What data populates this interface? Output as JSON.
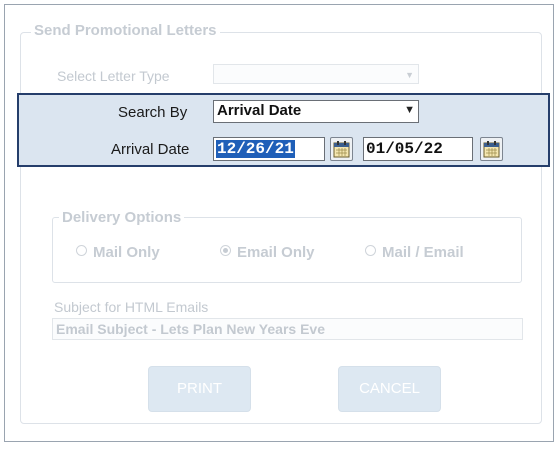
{
  "dialog": {
    "group_title": "Send Promotional Letters",
    "letter_type_label": "Select Letter Type",
    "letter_type_value": ""
  },
  "search": {
    "search_by_label": "Search By",
    "search_by_value": "Arrival Date",
    "date_label": "Arrival Date",
    "date_from": "12/26/21",
    "date_to": "01/05/22"
  },
  "delivery": {
    "title": "Delivery  Options",
    "options": [
      "Mail Only",
      "Email Only",
      "Mail / Email"
    ],
    "selected": "Email Only"
  },
  "email": {
    "subject_label": "Subject for HTML Emails",
    "subject_value": "Email Subject - Lets Plan New Years Eve"
  },
  "buttons": {
    "print": "PRINT",
    "cancel": "CANCEL"
  },
  "colors": {
    "highlight_bg": "#dbe5f0",
    "highlight_border": "#253e6b",
    "selection": "#1f5fb8",
    "disabled_text": "#c6ccd3"
  },
  "icons": {
    "dropdown": "chevron-down-icon",
    "calendar": "calendar-icon"
  }
}
